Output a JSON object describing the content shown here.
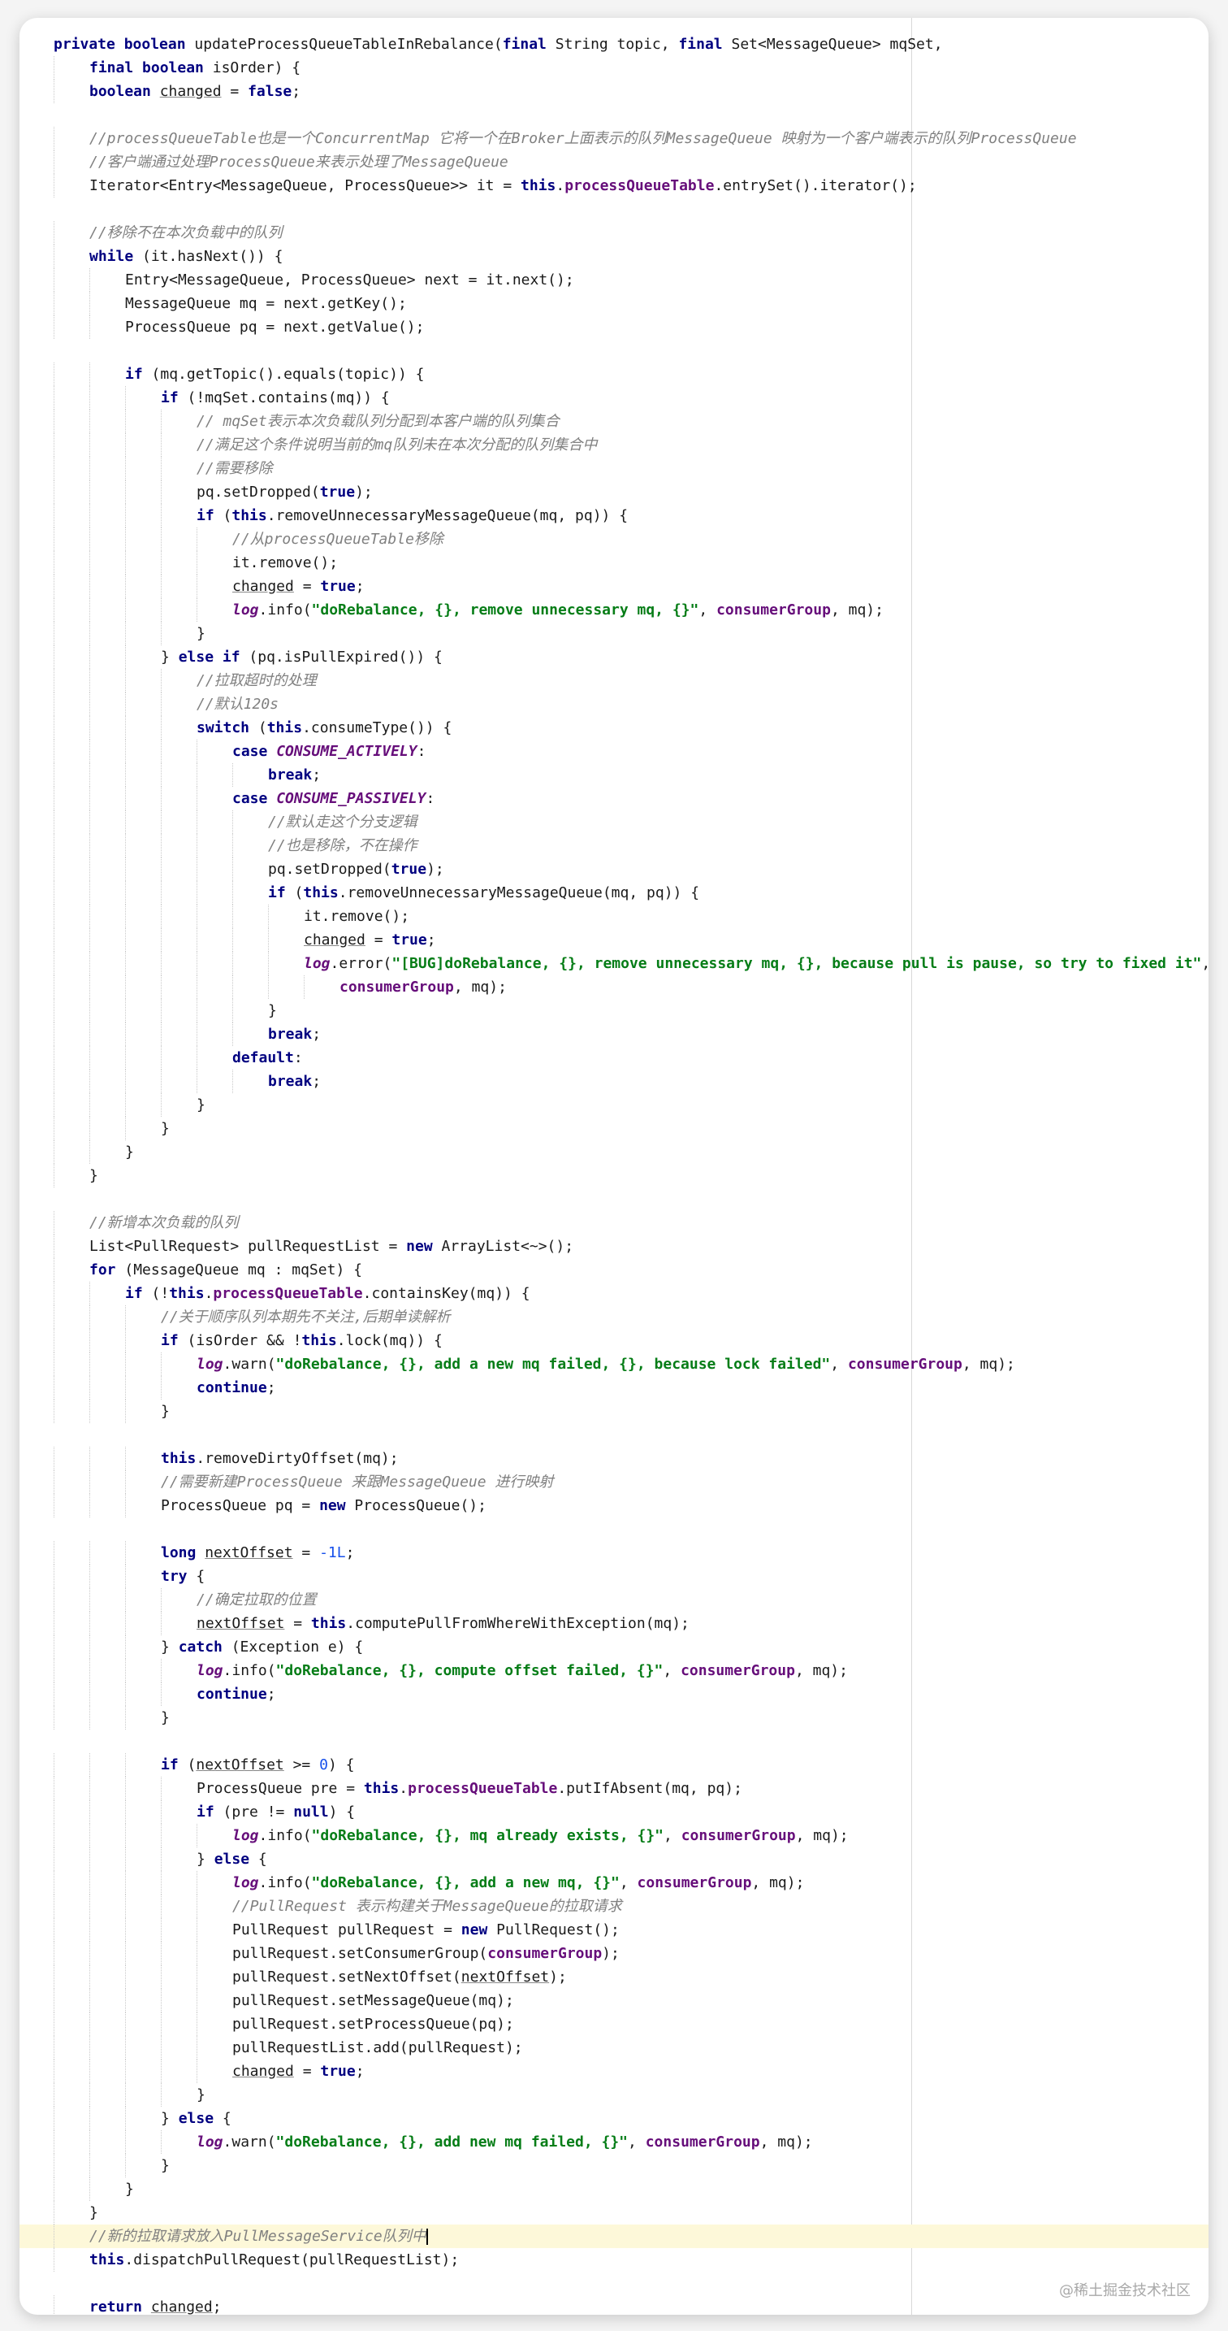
{
  "editor": {
    "watermark": "@稀土掘金技术社区",
    "lines": [
      {
        "i": 1,
        "t": "private boolean updateProcessQueueTableInRebalance(final String topic, final Set<MessageQueue> mqSet,"
      },
      {
        "i": 2,
        "t": "final boolean isOrder) {"
      },
      {
        "i": 2,
        "t": "boolean changed = false;"
      },
      {
        "i": 0,
        "t": ""
      },
      {
        "i": 2,
        "t": "//processQueueTable也是一个ConcurrentMap 它将一个在Broker上面表示的队列MessageQueue 映射为一个客户端表示的队列ProcessQueue",
        "c": true
      },
      {
        "i": 2,
        "t": "//客户端通过处理ProcessQueue来表示处理了MessageQueue",
        "c": true
      },
      {
        "i": 2,
        "t": "Iterator<Entry<MessageQueue, ProcessQueue>> it = this.processQueueTable.entrySet().iterator();"
      },
      {
        "i": 0,
        "t": ""
      },
      {
        "i": 2,
        "t": "//移除不在本次负载中的队列",
        "c": true
      },
      {
        "i": 2,
        "t": "while (it.hasNext()) {"
      },
      {
        "i": 3,
        "t": "Entry<MessageQueue, ProcessQueue> next = it.next();"
      },
      {
        "i": 3,
        "t": "MessageQueue mq = next.getKey();"
      },
      {
        "i": 3,
        "t": "ProcessQueue pq = next.getValue();"
      },
      {
        "i": 0,
        "t": ""
      },
      {
        "i": 3,
        "t": "if (mq.getTopic().equals(topic)) {"
      },
      {
        "i": 4,
        "t": "if (!mqSet.contains(mq)) {"
      },
      {
        "i": 5,
        "t": "// mqSet表示本次负载队列分配到本客户端的队列集合",
        "c": true
      },
      {
        "i": 5,
        "t": "//满足这个条件说明当前的mq队列未在本次分配的队列集合中",
        "c": true
      },
      {
        "i": 5,
        "t": "//需要移除",
        "c": true
      },
      {
        "i": 5,
        "t": "pq.setDropped(true);"
      },
      {
        "i": 5,
        "t": "if (this.removeUnnecessaryMessageQueue(mq, pq)) {"
      },
      {
        "i": 6,
        "t": "//从processQueueTable移除",
        "c": true
      },
      {
        "i": 6,
        "t": "it.remove();"
      },
      {
        "i": 6,
        "t": "changed = true;"
      },
      {
        "i": 6,
        "t": "log.info(\"doRebalance, {}, remove unnecessary mq, {}\", consumerGroup, mq);"
      },
      {
        "i": 5,
        "t": "}"
      },
      {
        "i": 4,
        "t": "} else if (pq.isPullExpired()) {"
      },
      {
        "i": 5,
        "t": "//拉取超时的处理",
        "c": true
      },
      {
        "i": 5,
        "t": "//默认120s",
        "c": true
      },
      {
        "i": 5,
        "t": "switch (this.consumeType()) {"
      },
      {
        "i": 6,
        "t": "case CONSUME_ACTIVELY:"
      },
      {
        "i": 7,
        "t": "break;"
      },
      {
        "i": 6,
        "t": "case CONSUME_PASSIVELY:"
      },
      {
        "i": 7,
        "t": "//默认走这个分支逻辑",
        "c": true
      },
      {
        "i": 7,
        "t": "//也是移除，不在操作",
        "c": true
      },
      {
        "i": 7,
        "t": "pq.setDropped(true);"
      },
      {
        "i": 7,
        "t": "if (this.removeUnnecessaryMessageQueue(mq, pq)) {"
      },
      {
        "i": 8,
        "t": "it.remove();"
      },
      {
        "i": 8,
        "t": "changed = true;"
      },
      {
        "i": 8,
        "t": "log.error(\"[BUG]doRebalance, {}, remove unnecessary mq, {}, because pull is pause, so try to fixed it\","
      },
      {
        "i": 9,
        "t": "consumerGroup, mq);"
      },
      {
        "i": 7,
        "t": "}"
      },
      {
        "i": 7,
        "t": "break;"
      },
      {
        "i": 6,
        "t": "default:"
      },
      {
        "i": 7,
        "t": "break;"
      },
      {
        "i": 5,
        "t": "}"
      },
      {
        "i": 4,
        "t": "}"
      },
      {
        "i": 3,
        "t": "}"
      },
      {
        "i": 2,
        "t": "}"
      },
      {
        "i": 0,
        "t": ""
      },
      {
        "i": 2,
        "t": "//新增本次负载的队列",
        "c": true
      },
      {
        "i": 2,
        "t": "List<PullRequest> pullRequestList = new ArrayList<~>();"
      },
      {
        "i": 2,
        "t": "for (MessageQueue mq : mqSet) {"
      },
      {
        "i": 3,
        "t": "if (!this.processQueueTable.containsKey(mq)) {"
      },
      {
        "i": 4,
        "t": "//关于顺序队列本期先不关注,后期单读解析",
        "c": true
      },
      {
        "i": 4,
        "t": "if (isOrder && !this.lock(mq)) {"
      },
      {
        "i": 5,
        "t": "log.warn(\"doRebalance, {}, add a new mq failed, {}, because lock failed\", consumerGroup, mq);"
      },
      {
        "i": 5,
        "t": "continue;"
      },
      {
        "i": 4,
        "t": "}"
      },
      {
        "i": 0,
        "t": ""
      },
      {
        "i": 4,
        "t": "this.removeDirtyOffset(mq);"
      },
      {
        "i": 4,
        "t": "//需要新建ProcessQueue 来跟MessageQueue 进行映射",
        "c": true
      },
      {
        "i": 4,
        "t": "ProcessQueue pq = new ProcessQueue();"
      },
      {
        "i": 0,
        "t": ""
      },
      {
        "i": 4,
        "t": "long nextOffset = -1L;"
      },
      {
        "i": 4,
        "t": "try {"
      },
      {
        "i": 5,
        "t": "//确定拉取的位置",
        "c": true
      },
      {
        "i": 5,
        "t": "nextOffset = this.computePullFromWhereWithException(mq);"
      },
      {
        "i": 4,
        "t": "} catch (Exception e) {"
      },
      {
        "i": 5,
        "t": "log.info(\"doRebalance, {}, compute offset failed, {}\", consumerGroup, mq);"
      },
      {
        "i": 5,
        "t": "continue;"
      },
      {
        "i": 4,
        "t": "}"
      },
      {
        "i": 0,
        "t": ""
      },
      {
        "i": 4,
        "t": "if (nextOffset >= 0) {"
      },
      {
        "i": 5,
        "t": "ProcessQueue pre = this.processQueueTable.putIfAbsent(mq, pq);"
      },
      {
        "i": 5,
        "t": "if (pre != null) {"
      },
      {
        "i": 6,
        "t": "log.info(\"doRebalance, {}, mq already exists, {}\", consumerGroup, mq);"
      },
      {
        "i": 5,
        "t": "} else {"
      },
      {
        "i": 6,
        "t": "log.info(\"doRebalance, {}, add a new mq, {}\", consumerGroup, mq);"
      },
      {
        "i": 6,
        "t": "//PullRequest 表示构建关于MessageQueue的拉取请求",
        "c": true
      },
      {
        "i": 6,
        "t": "PullRequest pullRequest = new PullRequest();"
      },
      {
        "i": 6,
        "t": "pullRequest.setConsumerGroup(consumerGroup);"
      },
      {
        "i": 6,
        "t": "pullRequest.setNextOffset(nextOffset);"
      },
      {
        "i": 6,
        "t": "pullRequest.setMessageQueue(mq);"
      },
      {
        "i": 6,
        "t": "pullRequest.setProcessQueue(pq);"
      },
      {
        "i": 6,
        "t": "pullRequestList.add(pullRequest);"
      },
      {
        "i": 6,
        "t": "changed = true;"
      },
      {
        "i": 5,
        "t": "}"
      },
      {
        "i": 4,
        "t": "} else {"
      },
      {
        "i": 5,
        "t": "log.warn(\"doRebalance, {}, add new mq failed, {}\", consumerGroup, mq);"
      },
      {
        "i": 4,
        "t": "}"
      },
      {
        "i": 3,
        "t": "}"
      },
      {
        "i": 2,
        "t": "}"
      },
      {
        "i": 2,
        "t": "//新的拉取请求放入PullMessageService队列中",
        "c": true,
        "hl": true
      },
      {
        "i": 2,
        "t": "this.dispatchPullRequest(pullRequestList);"
      },
      {
        "i": 0,
        "t": ""
      },
      {
        "i": 2,
        "t": "return changed;"
      }
    ]
  }
}
